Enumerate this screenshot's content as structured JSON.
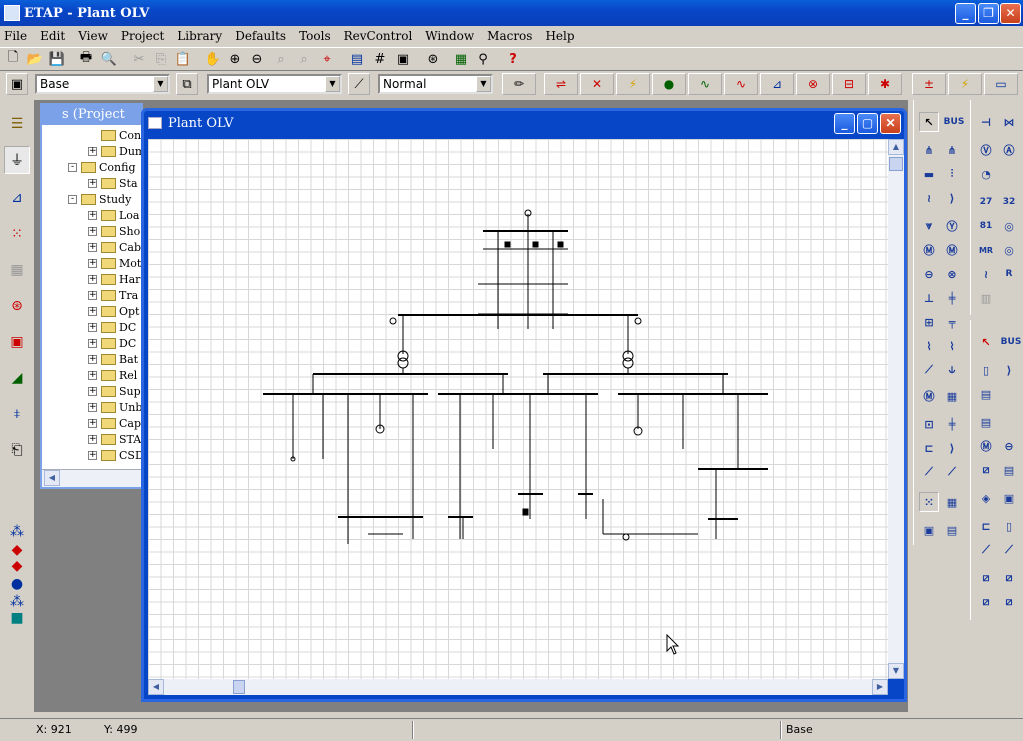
{
  "app_title": "ETAP - Plant OLV",
  "menu": [
    "File",
    "Edit",
    "View",
    "Project",
    "Library",
    "Defaults",
    "Tools",
    "RevControl",
    "Window",
    "Macros",
    "Help"
  ],
  "toolbar2": {
    "revision_combo": "Base",
    "presentation_combo": "Plant OLV",
    "mode_combo": "Normal"
  },
  "project_window": {
    "title": "s (Project",
    "items": [
      {
        "label": "Con",
        "level": 2,
        "expander": ""
      },
      {
        "label": "Dum",
        "level": 2,
        "expander": "+"
      },
      {
        "label": "Config",
        "level": 1,
        "expander": "-"
      },
      {
        "label": "Sta",
        "level": 2,
        "expander": "+"
      },
      {
        "label": "Study",
        "level": 1,
        "expander": "-"
      },
      {
        "label": "Loa",
        "level": 2,
        "expander": "+"
      },
      {
        "label": "Sho",
        "level": 2,
        "expander": "+"
      },
      {
        "label": "Cab",
        "level": 2,
        "expander": "+"
      },
      {
        "label": "Mot",
        "level": 2,
        "expander": "+"
      },
      {
        "label": "Har",
        "level": 2,
        "expander": "+"
      },
      {
        "label": "Tra",
        "level": 2,
        "expander": "+"
      },
      {
        "label": "Opt",
        "level": 2,
        "expander": "+"
      },
      {
        "label": "DC",
        "level": 2,
        "expander": "+"
      },
      {
        "label": "DC",
        "level": 2,
        "expander": "+"
      },
      {
        "label": "Bat",
        "level": 2,
        "expander": "+"
      },
      {
        "label": "Rel",
        "level": 2,
        "expander": "+"
      },
      {
        "label": "Sup",
        "level": 2,
        "expander": "+"
      },
      {
        "label": "Unb",
        "level": 2,
        "expander": "+"
      },
      {
        "label": "Cap",
        "level": 2,
        "expander": "+"
      },
      {
        "label": "STA",
        "level": 2,
        "expander": "+"
      },
      {
        "label": "CSD",
        "level": 2,
        "expander": "+"
      }
    ]
  },
  "olv_window": {
    "title": "Plant OLV"
  },
  "right_panel": {
    "bus_label": "BUS",
    "bus_label2": "BUS"
  },
  "relay_labels": [
    "27",
    "32",
    "81",
    "MR",
    "R"
  ],
  "status": {
    "x": "X: 921",
    "y": "Y: 499",
    "revision": "Base"
  }
}
